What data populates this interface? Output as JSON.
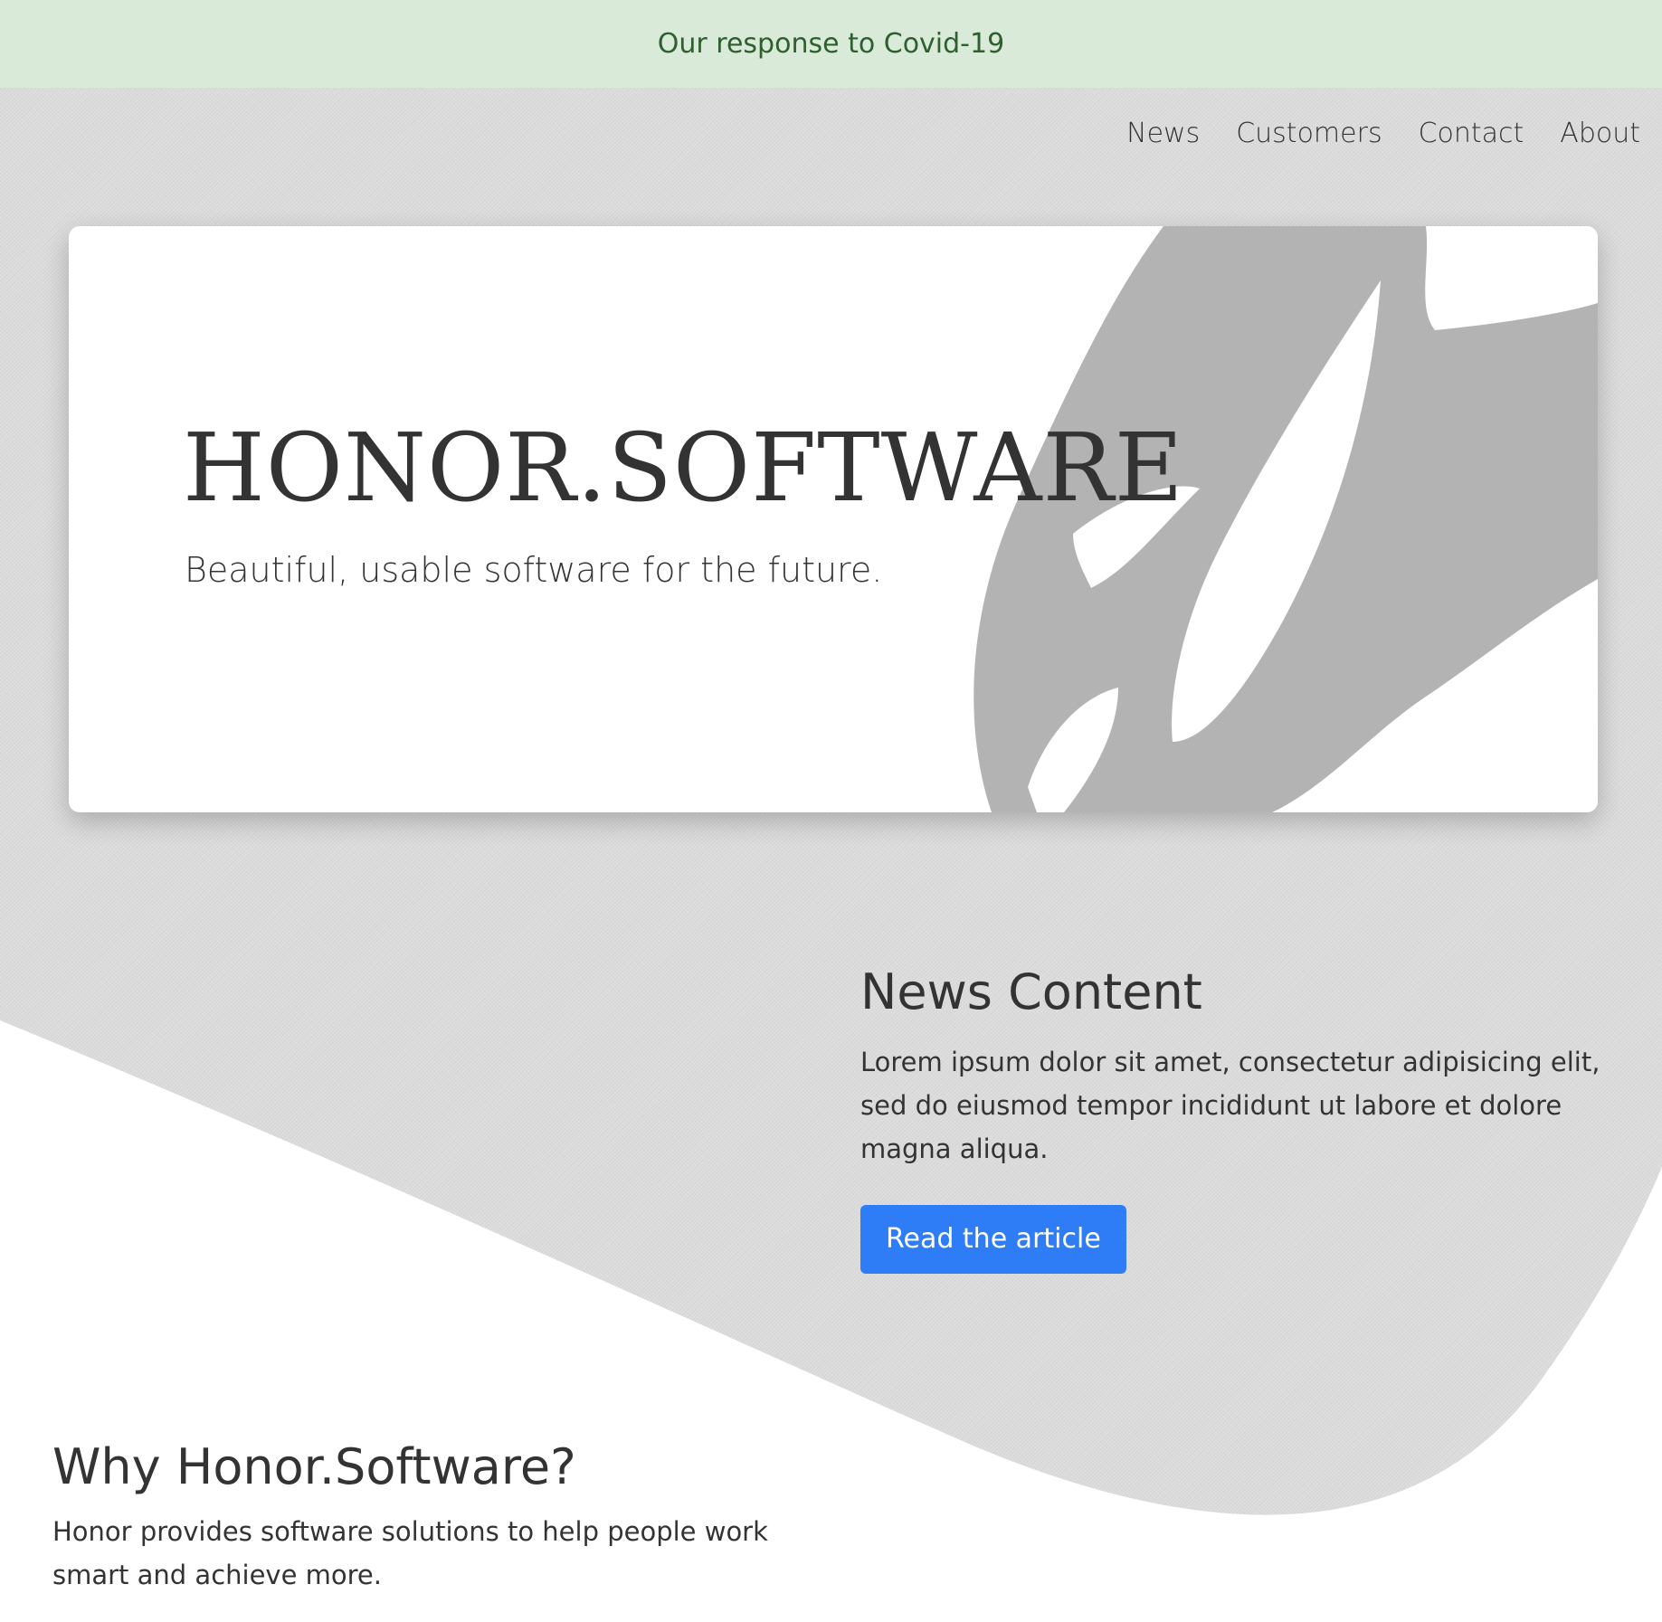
{
  "banner": {
    "text": "Our response to Covid-19",
    "color": "#d9ead9",
    "text_color": "#2e5f2e"
  },
  "nav": {
    "items": [
      {
        "label": "News"
      },
      {
        "label": "Customers"
      },
      {
        "label": "Contact"
      },
      {
        "label": "About"
      }
    ]
  },
  "hero": {
    "title": "HONOR.SOFTWARE",
    "subtitle": "Beautiful, usable software for the future.",
    "art_color": "#b3b3b3"
  },
  "news": {
    "heading": "News Content",
    "body": "Lorem ipsum dolor sit amet, consectetur adipisicing elit, sed do eiusmod tempor incididunt ut labore et dolore magna aliqua.",
    "button_label": "Read the article",
    "button_color": "#2f7df6"
  },
  "why": {
    "heading": "Why Honor.Software?",
    "body": "Honor provides software solutions to help people work smart and achieve more."
  }
}
